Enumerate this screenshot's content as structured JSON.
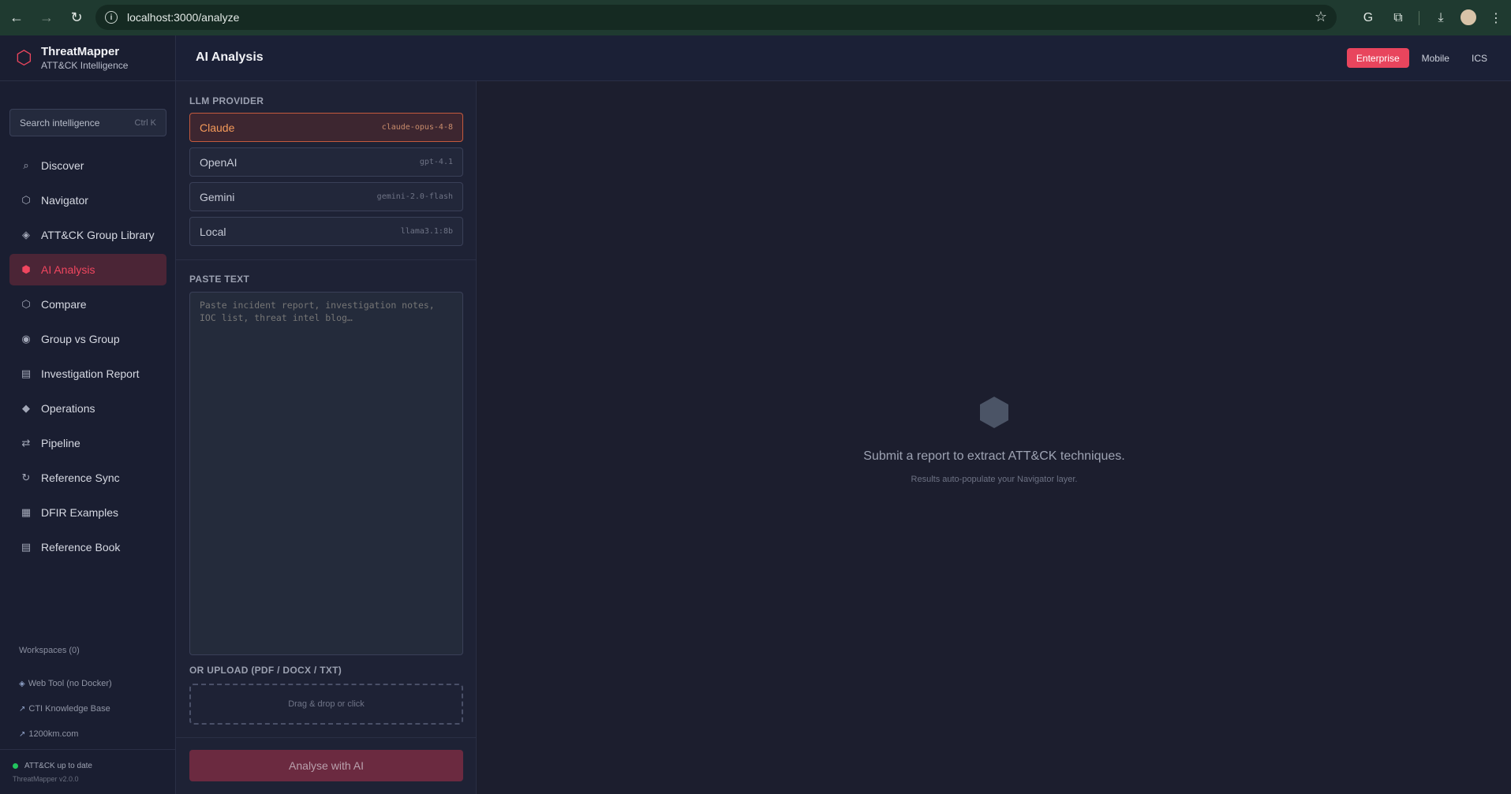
{
  "browser": {
    "url": "localhost:3000/analyze"
  },
  "sidebar": {
    "brand_title": "ThreatMapper",
    "brand_subtitle": "ATT&CK Intelligence",
    "search_placeholder": "Search intelligence",
    "search_shortcut": "Ctrl K",
    "items": [
      {
        "label": "Discover",
        "icon": "⌕"
      },
      {
        "label": "Navigator",
        "icon": "⬡"
      },
      {
        "label": "ATT&CK Group Library",
        "icon": "◈"
      },
      {
        "label": "AI Analysis",
        "icon": "⬢"
      },
      {
        "label": "Compare",
        "icon": "⬡"
      },
      {
        "label": "Group vs Group",
        "icon": "◉"
      },
      {
        "label": "Investigation Report",
        "icon": "▤"
      },
      {
        "label": "Operations",
        "icon": "◆"
      },
      {
        "label": "Pipeline",
        "icon": "⇄"
      },
      {
        "label": "Reference Sync",
        "icon": "↻"
      },
      {
        "label": "DFIR Examples",
        "icon": "▦"
      },
      {
        "label": "Reference Book",
        "icon": "▤"
      }
    ],
    "workspaces_label": "Workspaces (0)",
    "links": [
      {
        "icon": "◈",
        "label": "Web Tool (no Docker)"
      },
      {
        "icon": "↗",
        "label": "CTI Knowledge Base"
      },
      {
        "icon": "↗",
        "label": "1200km.com"
      }
    ],
    "status_text": "ATT&CK up to date",
    "version": "ThreatMapper v2.0.0"
  },
  "header": {
    "title": "AI Analysis",
    "domains": [
      "Enterprise",
      "Mobile",
      "ICS"
    ],
    "active_domain": "Enterprise"
  },
  "panel": {
    "provider_label": "LLM PROVIDER",
    "providers": [
      {
        "name": "Claude",
        "model": "claude-opus-4-8"
      },
      {
        "name": "OpenAI",
        "model": "gpt-4.1"
      },
      {
        "name": "Gemini",
        "model": "gemini-2.0-flash"
      },
      {
        "name": "Local",
        "model": "llama3.1:8b"
      }
    ],
    "selected_provider": "Claude",
    "paste_label": "PASTE TEXT",
    "paste_placeholder": "Paste incident report, investigation notes, IOC list, threat intel blog…",
    "upload_label": "OR UPLOAD (PDF / DOCX / TXT)",
    "upload_hint": "Drag & drop or click",
    "analyse_button": "Analyse with AI"
  },
  "main": {
    "empty_message": "Submit a report to extract ATT&CK techniques.",
    "empty_sub": "Results auto-populate your Navigator layer."
  }
}
